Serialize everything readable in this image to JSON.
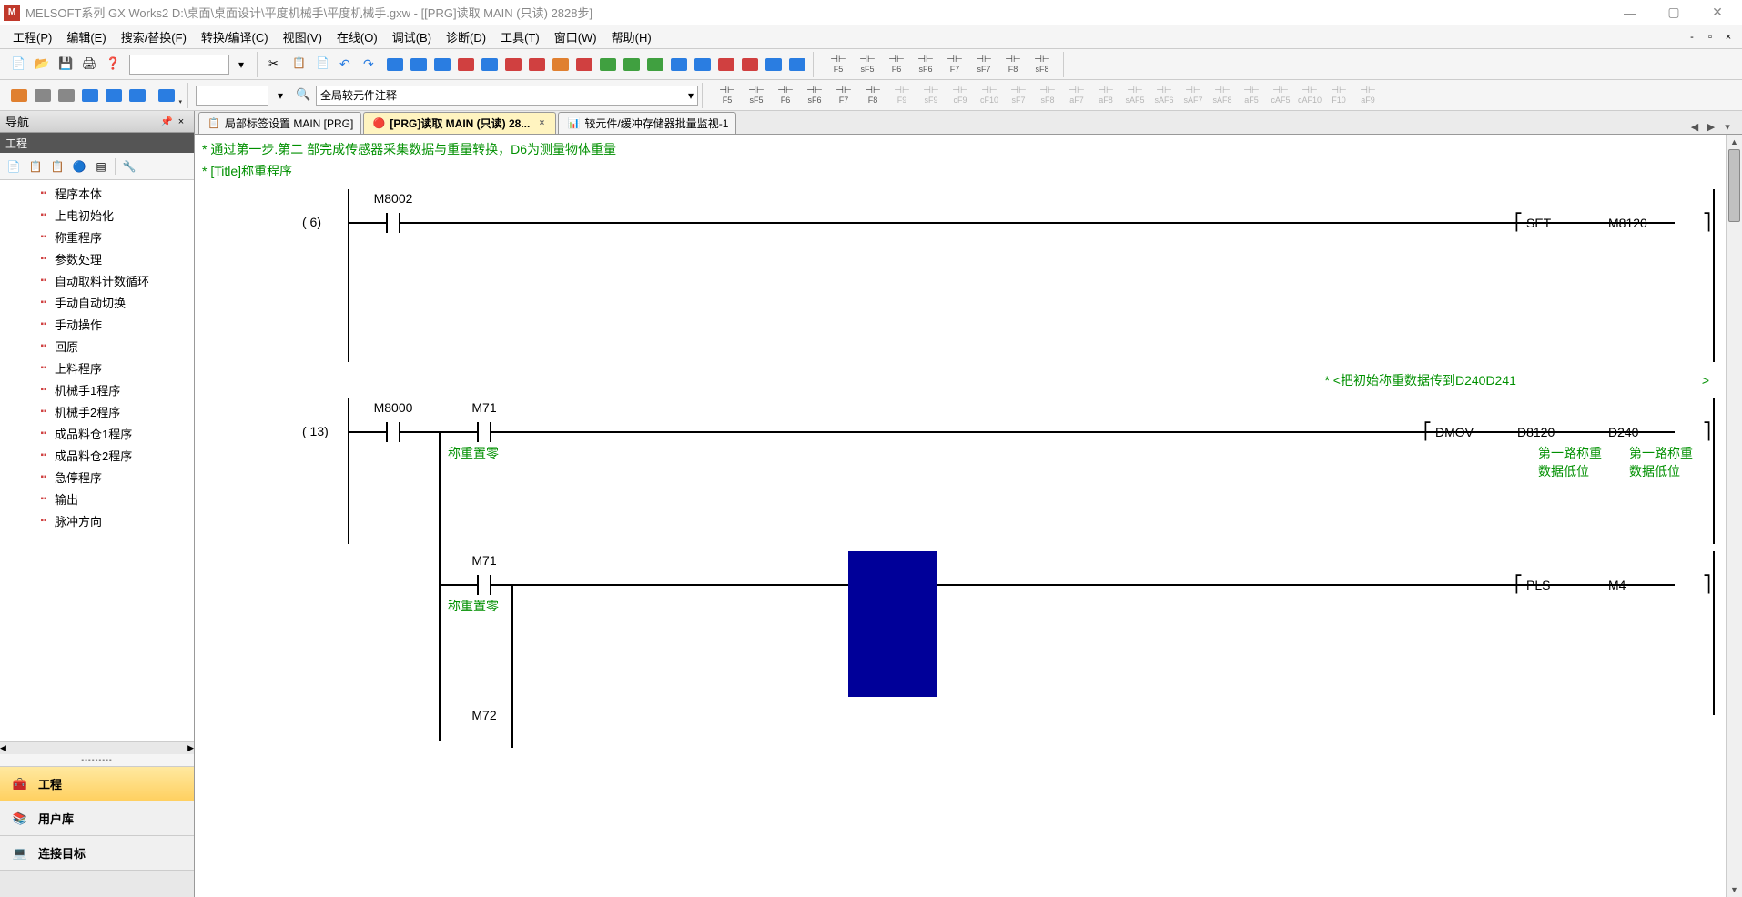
{
  "title": "MELSOFT系列 GX Works2 D:\\桌面\\桌面设计\\平度机械手\\平度机械手.gxw - [[PRG]读取 MAIN (只读) 2828步]",
  "menus": [
    "工程(P)",
    "编辑(E)",
    "搜索/替换(F)",
    "转换/编译(C)",
    "视图(V)",
    "在线(O)",
    "调试(B)",
    "诊断(D)",
    "工具(T)",
    "窗口(W)",
    "帮助(H)"
  ],
  "toolbar2": {
    "combo": "全局较元件注释"
  },
  "nav": {
    "title": "导航",
    "category": "工程",
    "tree": [
      "程序本体",
      "上电初始化",
      "称重程序",
      "参数处理",
      "自动取料计数循环",
      "手动自动切换",
      "手动操作",
      "回原",
      "上料程序",
      "机械手1程序",
      "机械手2程序",
      "成品料仓1程序",
      "成品料仓2程序",
      "急停程序",
      "输出",
      "脉冲方向"
    ],
    "bigButtons": [
      {
        "label": "工程",
        "active": true
      },
      {
        "label": "用户库",
        "active": false
      },
      {
        "label": "连接目标",
        "active": false
      }
    ]
  },
  "tabs": [
    {
      "label": "局部标签设置 MAIN [PRG]",
      "active": false,
      "closable": false
    },
    {
      "label": "[PRG]读取 MAIN (只读) 28...",
      "active": true,
      "closable": true
    },
    {
      "label": "较元件/缓冲存储器批量监视-1",
      "active": false,
      "closable": false
    }
  ],
  "ladder": {
    "comment1": "* 通过第一步.第二 部完成传感器采集数据与重量转换，D6为测量物体重量",
    "title": "* [Title]称重程序",
    "rung1": {
      "step": "(    6)",
      "contact1": "M8002",
      "coil": {
        "instr": "SET",
        "op1": "M8120"
      }
    },
    "rung2": {
      "comment": "* <把初始称重数据传到D240D241",
      "commentEnd": ">",
      "step": "(   13)",
      "contact1": "M8000",
      "contact2": "M71",
      "contact2comment": "称重置零",
      "coil": {
        "instr": "DMOV",
        "op1": "D8120",
        "op2": "D240"
      },
      "op1comment": "第一路称重数据低位",
      "op2comment": "第一路称重数据低位"
    },
    "rung3": {
      "contact1": "M71",
      "contact1comment": "称重置零",
      "coil": {
        "instr": "PLS",
        "op1": "M4"
      }
    },
    "rung4": {
      "contact1": "M72"
    }
  },
  "fkeys1": [
    "F5",
    "sF5",
    "F6",
    "sF6",
    "F7",
    "F8",
    "F9",
    "sF9",
    "cF9",
    "cF10",
    "sF7",
    "sF8",
    "aF7",
    "aF8",
    "sAF5",
    "sAF6",
    "sAF7",
    "sAF8",
    "aF5",
    "cAF5",
    "cAF10",
    "F10",
    "aF9"
  ],
  "fkeys2": [
    "F5",
    "sF5",
    "F6",
    "sF6",
    "F7",
    "sF7",
    "F8",
    "sF8"
  ]
}
